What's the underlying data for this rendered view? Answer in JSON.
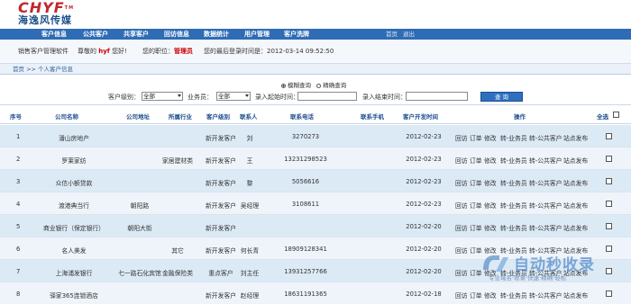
{
  "brand": {
    "name_en": "CHYF",
    "tm": "TM",
    "name_cn": "海逸风传媒"
  },
  "nav": {
    "items": [
      "客户信息",
      "公共客户",
      "共享客户",
      "回访信息",
      "数据统计",
      "用户管理",
      "客户洗牌"
    ],
    "home": "首页",
    "logout": "退出"
  },
  "info": {
    "system": "销售客户管理软件",
    "greeting_pre": "尊敬的",
    "user": "hyf",
    "greeting_post": "您好!",
    "role_label": "您的职位：",
    "role": "管理员",
    "last_login_label": "您的最后登录时间是：",
    "last_login": "2012-03-14 09:52:50"
  },
  "breadcrumb": "首页 >> 个人客户信息",
  "search": {
    "fuzzy": "模糊查询",
    "exact": "精确查询",
    "level_label": "客户级别：",
    "level_value": "全部",
    "staff_label": "业务员：",
    "staff_value": "全部",
    "start_label": "录入起始时间：",
    "end_label": "录入结束时间：",
    "query_button": "查 询"
  },
  "table": {
    "headers": {
      "no": "序号",
      "company": "公司名称",
      "address": "公司地址",
      "industry": "所属行业",
      "level": "客户级别",
      "contact": "联系人",
      "phone": "联系电话",
      "mobile": "联系手机",
      "dev_time": "客户开发时间",
      "ops": "操作",
      "select_all": "全选"
    },
    "op_labels": {
      "visit": "回访",
      "order": "订单",
      "edit": "修改",
      "to_staff": "转-业务员",
      "to_public": "转-公共客户",
      "publish": "站点发布"
    },
    "rows": [
      {
        "no": "1",
        "company": "潘山房地产",
        "address": "",
        "industry": "",
        "level": "新开发客户",
        "contact": "刘",
        "phone": "3270273",
        "mobile": "",
        "time": "2012-02-23"
      },
      {
        "no": "2",
        "company": "罗莱家纺",
        "address": "",
        "industry": "家居建材类",
        "level": "新开发客户",
        "contact": "王",
        "phone": "13231298523",
        "mobile": "",
        "time": "2012-02-23"
      },
      {
        "no": "3",
        "company": "众信小额贷款",
        "address": "",
        "industry": "",
        "level": "新开发客户",
        "contact": "黎",
        "phone": "5056616",
        "mobile": "",
        "time": "2012-02-23"
      },
      {
        "no": "4",
        "company": "渡港典当行",
        "address": "朝阳路",
        "industry": "",
        "level": "新开发客户",
        "contact": "吴经理",
        "phone": "3108611",
        "mobile": "",
        "time": "2012-02-23"
      },
      {
        "no": "5",
        "company": "商业银行（保定银行）",
        "address": "朝阳大街",
        "industry": "",
        "level": "新开发客户",
        "contact": "",
        "phone": "",
        "mobile": "",
        "time": "2012-02-20"
      },
      {
        "no": "6",
        "company": "名人美发",
        "address": "",
        "industry": "其它",
        "level": "新开发客户",
        "contact": "何长青",
        "phone": "18909128341",
        "mobile": "",
        "time": "2012-02-20"
      },
      {
        "no": "7",
        "company": "上海浦发银行",
        "address": "七一路石化宾馆",
        "industry": "金融保险类",
        "level": "重点客户",
        "contact": "刘主任",
        "phone": "13931257766",
        "mobile": "",
        "time": "2012-02-20"
      },
      {
        "no": "8",
        "company": "驿家365连锁酒店",
        "address": "",
        "industry": "",
        "level": "新开发客户",
        "contact": "赵经理",
        "phone": "18631191365",
        "mobile": "",
        "time": "2012-02-18"
      }
    ]
  },
  "watermark": {
    "big": "自动秒收录",
    "small": "专业域名·收录·快速·精确·轻松"
  },
  "colors": {
    "nav_bg": "#2e6cb5",
    "row_odd": "#dceaf6",
    "row_even": "#eef4fa",
    "brand_red": "#c1272d",
    "header_text": "#1d4f8c"
  }
}
